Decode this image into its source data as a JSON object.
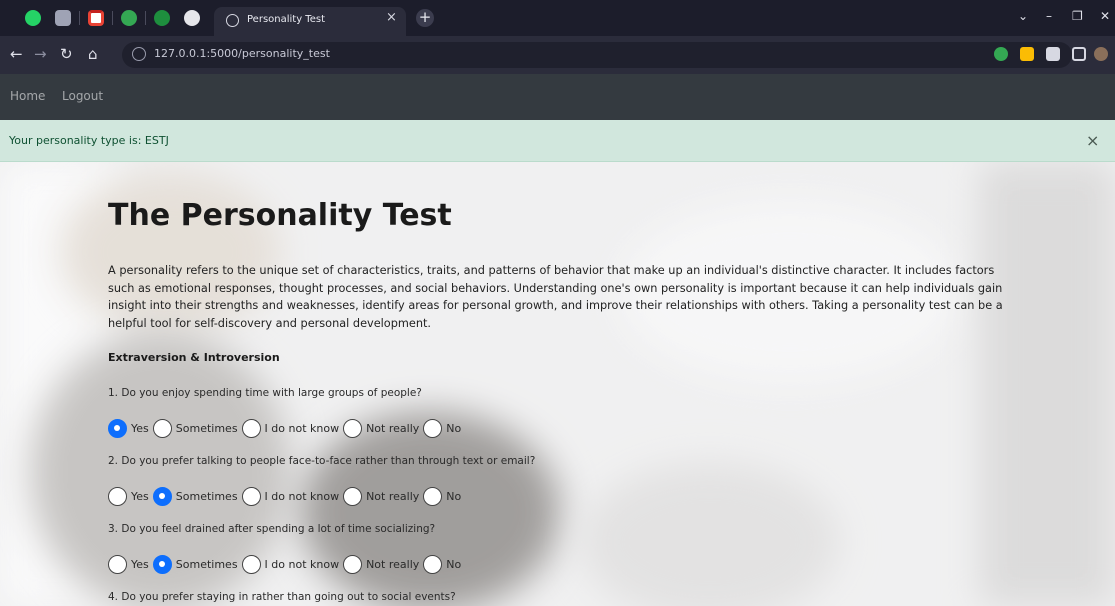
{
  "browser": {
    "tab_title": "Personality Test",
    "tab_close": "×",
    "new_tab": "+",
    "url": "127.0.0.1:5000/personality_test",
    "window_controls": {
      "chevron": "⌄",
      "minimize": "–",
      "restore": "❐",
      "close": "✕"
    },
    "nav": {
      "back": "←",
      "forward": "→",
      "reload": "↻",
      "home": "⌂"
    }
  },
  "navbar": {
    "links": [
      "Home",
      "Logout"
    ]
  },
  "alert": {
    "text": "Your personality type is: ESTJ",
    "close": "×"
  },
  "page": {
    "title": "The Personality Test",
    "intro": "A personality refers to the unique set of characteristics, traits, and patterns of behavior that make up an individual's distinctive character. It includes factors such as emotional responses, thought processes, and social behaviors. Understanding one's own personality is important because it can help individuals gain insight into their strengths and weaknesses, identify areas for personal growth, and improve their relationships with others. Taking a personality test can be a helpful tool for self-discovery and personal development.",
    "section": "Extraversion & Introversion",
    "options": [
      "Yes",
      "Sometimes",
      "I do not know",
      "Not really",
      "No"
    ],
    "questions": [
      {
        "text": "1. Do you enjoy spending time with large groups of people?",
        "selected": "Yes"
      },
      {
        "text": "2. Do you prefer talking to people face-to-face rather than through text or email?",
        "selected": "Sometimes"
      },
      {
        "text": "3. Do you feel drained after spending a lot of time socializing?",
        "selected": "Sometimes"
      },
      {
        "text": "4. Do you prefer staying in rather than going out to social events?",
        "selected": ""
      }
    ]
  },
  "colors": {
    "accent": "#0d6efd",
    "navbar": "#343a40",
    "alert_bg": "#d1e7dd",
    "alert_text": "#0f5132",
    "tabstrip": "#1c1d2b"
  }
}
